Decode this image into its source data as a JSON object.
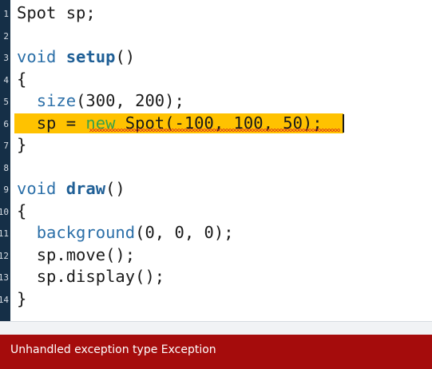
{
  "editor": {
    "lines": [
      {
        "number": "1",
        "text": "Spot sp;"
      },
      {
        "number": "2",
        "text": ""
      },
      {
        "number": "3",
        "kw": "void",
        "name": "setup",
        "rest": "()"
      },
      {
        "number": "4",
        "text": "{"
      },
      {
        "number": "5",
        "name": "size",
        "rest": "(300, 200);"
      },
      {
        "number": "6",
        "lead": "sp = ",
        "kw": "new",
        "rest": " Spot(-100, 100, 50);"
      },
      {
        "number": "7",
        "text": "}"
      },
      {
        "number": "8",
        "text": ""
      },
      {
        "number": "9",
        "kw": "void",
        "name": "draw",
        "rest": "()"
      },
      {
        "number": "10",
        "text": "{"
      },
      {
        "number": "11",
        "name": "background",
        "rest": "(0, 0, 0);"
      },
      {
        "number": "12",
        "text": "sp.move();"
      },
      {
        "number": "13",
        "text": "sp.display();"
      },
      {
        "number": "14",
        "text": "}"
      }
    ],
    "error_line_number": "6"
  },
  "status": {
    "message": "Unhandled exception type Exception",
    "color": "#a50c0c"
  },
  "colors": {
    "gutter": "#152f47",
    "error_highlight": "#ffc200",
    "keyword": "#2b6fa8",
    "new_keyword": "#3aa14a",
    "squiggle": "#d9281c"
  }
}
